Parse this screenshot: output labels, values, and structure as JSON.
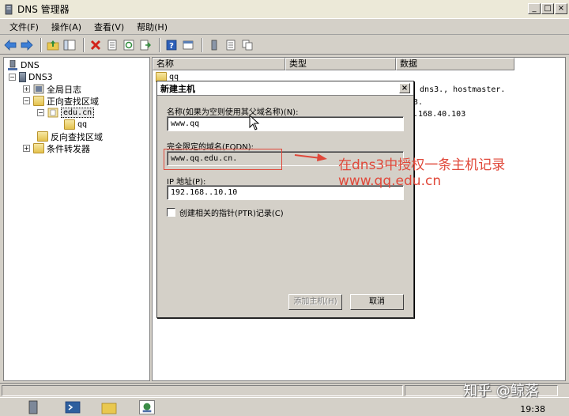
{
  "window": {
    "title": "DNS 管理器",
    "controls": [
      "_",
      "□",
      "×"
    ]
  },
  "menu": [
    "文件(F)",
    "操作(A)",
    "查看(V)",
    "帮助(H)"
  ],
  "toolbar_icons": [
    "back-arrow-icon",
    "forward-arrow-icon",
    "up-folder-icon",
    "console-tree-icon",
    "delete-icon",
    "properties-icon",
    "refresh-icon",
    "export-icon",
    "help-icon",
    "mmc-icon",
    "server-icon",
    "list-icon",
    "copy-icon"
  ],
  "tree": {
    "root": "DNS",
    "server": "DNS3",
    "global_logs": "全局日志",
    "forward_zones": "正向查找区域",
    "zone": "edu.cn",
    "subdomain": "qq",
    "reverse_zones": "反向查找区域",
    "conditional_forwarders": "条件转发器"
  },
  "list": {
    "columns": [
      "名称",
      "类型",
      "数据"
    ],
    "row_name": "qq",
    "soa_fragment": ", dns3., hostmaster.",
    "ns_fragment": "3.",
    "a_fragment": ".168.40.103"
  },
  "dialog": {
    "title": "新建主机",
    "name_label": "名称(如果为空则使用其父域名称)(N):",
    "name_value": "www.qq",
    "fqdn_label": "完全限定的域名(FQDN):",
    "fqdn_value": "www.qq.edu.cn.",
    "ip_label": "IP 地址(P):",
    "ip_value": "192.168..10.10",
    "ptr_label": "创建相关的指针(PTR)记录(C)",
    "ptr_checked": false,
    "add_button": "添加主机(H)",
    "cancel_button": "取消",
    "close": "×"
  },
  "annotation": {
    "line1": "在dns3中授权一条主机记录",
    "line2": "www.qq.edu.cn",
    "color": "#e0483a"
  },
  "watermark": "知乎 @鲸落",
  "taskbar": {
    "clock": "19:38"
  }
}
